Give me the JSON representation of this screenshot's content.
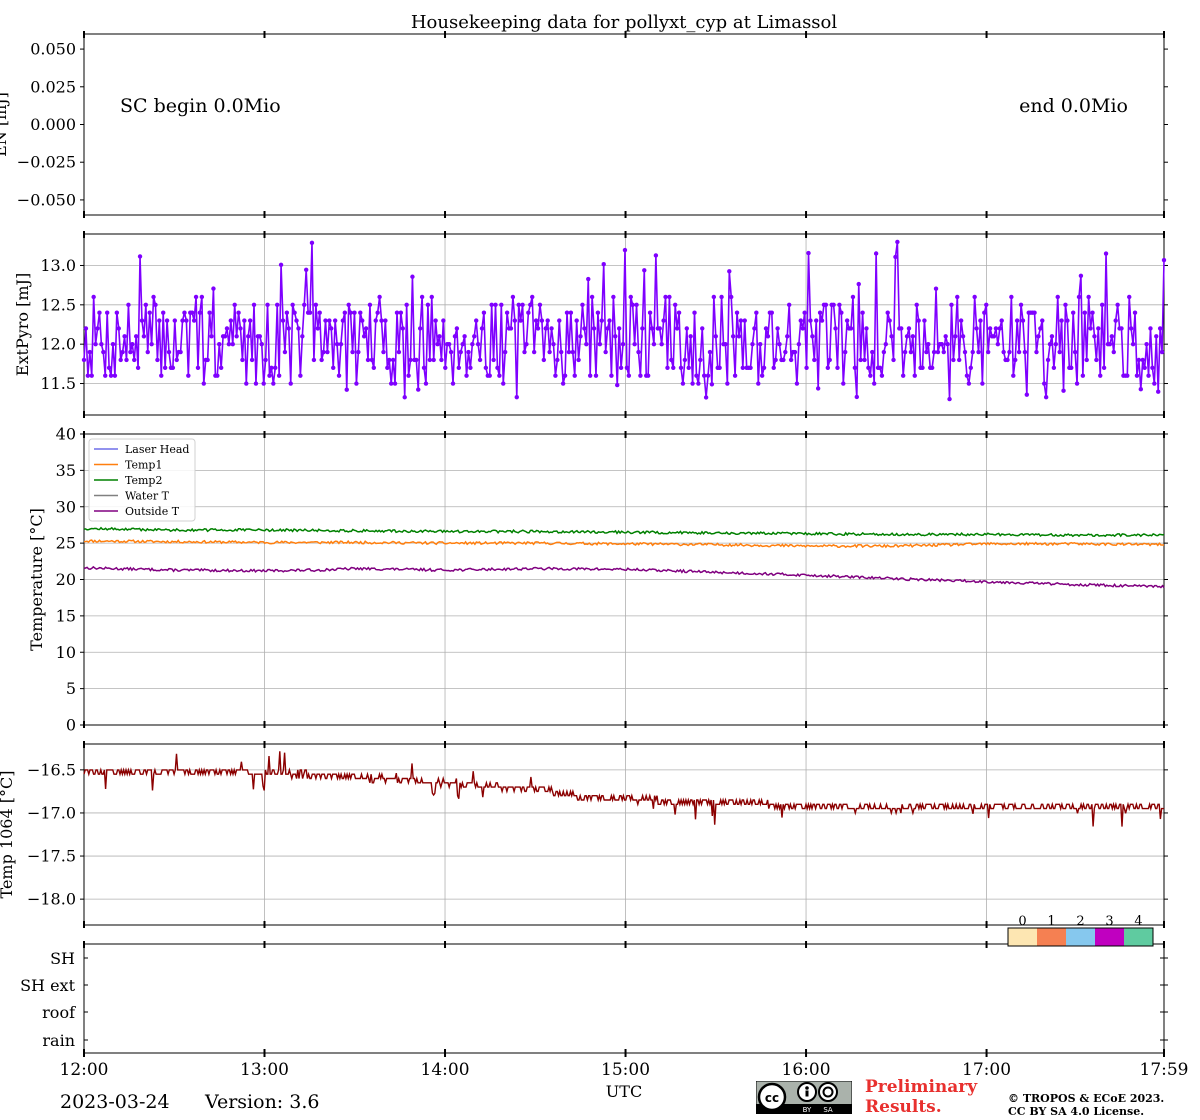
{
  "title": "Housekeeping data for pollyxt_cyp at Limassol",
  "x_axis": {
    "label": "UTC",
    "range_hours": [
      12.0,
      17.983
    ],
    "tick_hours": [
      12,
      13,
      14,
      15,
      16,
      17,
      17.983
    ],
    "tick_labels": [
      "12:00",
      "13:00",
      "14:00",
      "15:00",
      "16:00",
      "17:00",
      "17:59"
    ]
  },
  "footer": {
    "date": "2023-03-24",
    "version": "Version: 3.6",
    "preliminary_line1": "Preliminary",
    "preliminary_line2": "Results.",
    "copyright_line1": "© TROPOS & ECoE 2023.",
    "copyright_line2": "CC BY SA 4.0 License.",
    "cc_badge": {
      "by": "BY",
      "sa": "SA"
    }
  },
  "colors": {
    "extpyro": "#7f00ff",
    "laser_head": "#6e6ee8",
    "temp1": "#ff7f0e",
    "temp2": "#008000",
    "water_t": "#808080",
    "outside_t": "#800080",
    "temp1064": "#8b0000",
    "grid": "#b0b0b0",
    "prelim": "#e8302e"
  },
  "chart_data": [
    {
      "id": "energy",
      "type": "line",
      "ylabel": "EN [mJ]",
      "ylim": [
        -0.06,
        0.06
      ],
      "yticks": [
        -0.05,
        -0.025,
        0.0,
        0.025,
        0.05
      ],
      "ytick_labels": [
        "−0.050",
        "−0.025",
        "0.000",
        "0.025",
        "0.050"
      ],
      "grid": false,
      "annotations": [
        "SC begin 0.0Mio",
        "end 0.0Mio"
      ],
      "series": []
    },
    {
      "id": "extpyro",
      "type": "line",
      "ylabel": "ExtPyro [mJ]",
      "ylim": [
        11.1,
        13.4
      ],
      "yticks": [
        11.5,
        12.0,
        12.5,
        13.0
      ],
      "ytick_labels": [
        "11.5",
        "12.0",
        "12.5",
        "13.0"
      ],
      "grid": true,
      "markers": true,
      "series": [
        {
          "color_key": "extpyro",
          "mean": 12.05,
          "min": 11.2,
          "max": 13.3
        }
      ]
    },
    {
      "id": "temperature",
      "type": "line",
      "ylabel": "Temperature [$^\\circ C$]",
      "ylim": [
        0,
        40
      ],
      "yticks": [
        0,
        5,
        10,
        15,
        20,
        25,
        30,
        35,
        40
      ],
      "ytick_labels": [
        "0",
        "5",
        "10",
        "15",
        "20",
        "25",
        "30",
        "35",
        "40"
      ],
      "grid": true,
      "legend_position": "top-left",
      "series": [
        {
          "name": "Laser Head",
          "color_key": "laser_head",
          "hours": [],
          "values": []
        },
        {
          "name": "Temp1",
          "color_key": "temp1",
          "hours": [
            12.0,
            12.5,
            13.0,
            13.5,
            14.0,
            14.5,
            15.0,
            15.5,
            16.0,
            16.5,
            17.0,
            17.5,
            17.98
          ],
          "values": [
            25.3,
            25.2,
            25.1,
            25.1,
            25.0,
            25.0,
            24.9,
            24.8,
            24.6,
            24.6,
            24.9,
            24.9,
            24.8
          ]
        },
        {
          "name": "Temp2",
          "color_key": "temp2",
          "hours": [
            12.0,
            12.5,
            13.0,
            13.5,
            14.0,
            14.5,
            15.0,
            15.5,
            16.0,
            16.5,
            17.0,
            17.5,
            17.98
          ],
          "values": [
            27.0,
            26.8,
            26.8,
            26.7,
            26.6,
            26.6,
            26.5,
            26.4,
            26.3,
            26.2,
            26.2,
            26.1,
            26.1
          ]
        },
        {
          "name": "Water T",
          "color_key": "water_t",
          "hours": [],
          "values": []
        },
        {
          "name": "Outside T",
          "color_key": "outside_t",
          "hours": [
            12.0,
            12.5,
            13.0,
            13.3,
            13.5,
            14.0,
            14.5,
            15.0,
            15.5,
            16.0,
            16.5,
            17.0,
            17.5,
            17.98
          ],
          "values": [
            21.6,
            21.3,
            21.2,
            21.3,
            21.5,
            21.3,
            21.5,
            21.4,
            21.0,
            20.6,
            20.1,
            19.7,
            19.3,
            19.0
          ]
        }
      ]
    },
    {
      "id": "temp1064",
      "type": "line",
      "ylabel": "Temp 1064 [$^\\circ C$]",
      "ylim": [
        -18.3,
        -16.2
      ],
      "yticks": [
        -18.0,
        -17.5,
        -17.0,
        -16.5
      ],
      "ytick_labels": [
        "−18.0",
        "−17.5",
        "−17.0",
        "−16.5"
      ],
      "grid": true,
      "series": [
        {
          "color_key": "temp1064",
          "hours": [
            12.0,
            12.5,
            13.0,
            13.6,
            14.0,
            14.5,
            14.8,
            15.2,
            15.6,
            16.0,
            16.5,
            17.0,
            17.5,
            17.98
          ],
          "values": [
            -16.52,
            -16.52,
            -16.53,
            -16.6,
            -16.65,
            -16.72,
            -16.82,
            -16.85,
            -16.88,
            -16.92,
            -16.95,
            -16.92,
            -16.93,
            -16.93
          ]
        }
      ]
    },
    {
      "id": "status",
      "type": "heatmap",
      "ylabels": [
        "SH",
        "SH ext",
        "roof",
        "rain"
      ],
      "colorbar": {
        "labels": [
          "0",
          "1",
          "2",
          "3",
          "4"
        ],
        "colors": [
          "#fde6b2",
          "#f58052",
          "#86c8ee",
          "#c000c0",
          "#5fcba0"
        ]
      }
    }
  ]
}
